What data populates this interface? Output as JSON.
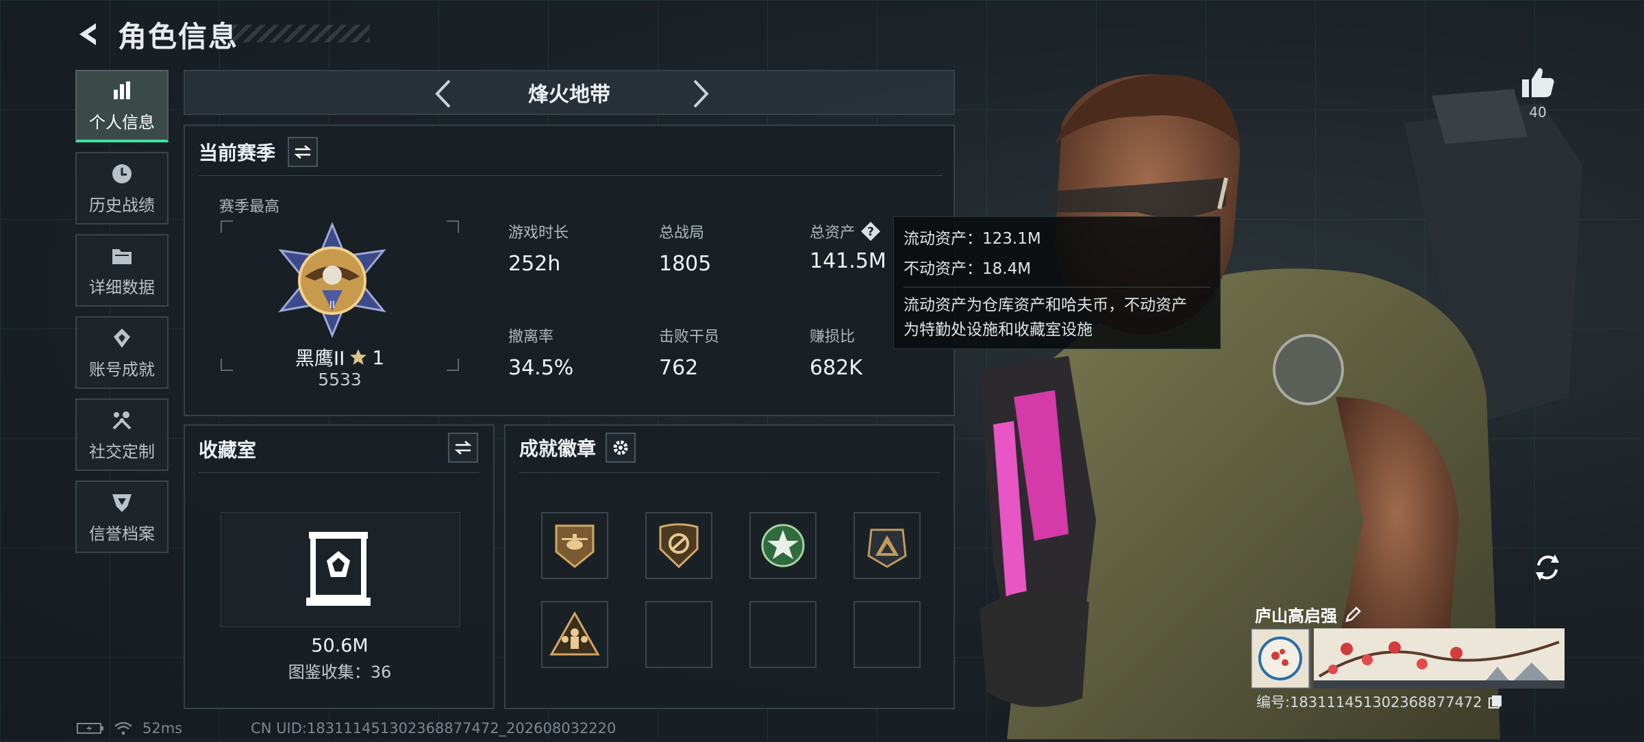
{
  "header": {
    "title": "角色信息"
  },
  "sidebar": {
    "items": [
      {
        "label": "个人信息",
        "icon": "bar-chart-icon",
        "active": true
      },
      {
        "label": "历史战绩",
        "icon": "clock-icon"
      },
      {
        "label": "详细数据",
        "icon": "folder-icon"
      },
      {
        "label": "账号成就",
        "icon": "achievement-icon"
      },
      {
        "label": "社交定制",
        "icon": "tools-icon"
      },
      {
        "label": "信誉档案",
        "icon": "shield-icon"
      }
    ]
  },
  "mode": {
    "title": "烽火地带"
  },
  "season": {
    "title": "当前赛季",
    "best_label": "赛季最高",
    "rank_name": "黑鹰II",
    "rank_stars": "1",
    "rank_score": "5533",
    "stats": [
      {
        "label": "游戏时长",
        "value": "252h"
      },
      {
        "label": "总战局",
        "value": "1805"
      },
      {
        "label": "总资产",
        "value": "141.5M"
      },
      {
        "label": "撤离率",
        "value": "34.5%"
      },
      {
        "label": "击败干员",
        "value": "762"
      },
      {
        "label": "赚损比",
        "value": "682K"
      }
    ]
  },
  "tooltip": {
    "liquid": "流动资产：123.1M",
    "fixed": "不动资产：18.4M",
    "note_1": "流动资产为仓库资产和哈夫币，不动资产",
    "note_2": "为特勤处设施和收藏室设施"
  },
  "collection": {
    "title": "收藏室",
    "value": "50.6M",
    "catalog": "图鉴收集：36"
  },
  "badges": {
    "title": "成就徽章"
  },
  "player": {
    "name": "庐山高启强",
    "id": "编号:1831114513023688774​72",
    "likes": "40"
  },
  "footer": {
    "ping": "52ms",
    "uid": "CN UID:18311145130236887​7472_202608032220"
  },
  "colors": {
    "accent": "#3de0a0",
    "panel_bg": "#181f25",
    "border": "#36424a"
  }
}
